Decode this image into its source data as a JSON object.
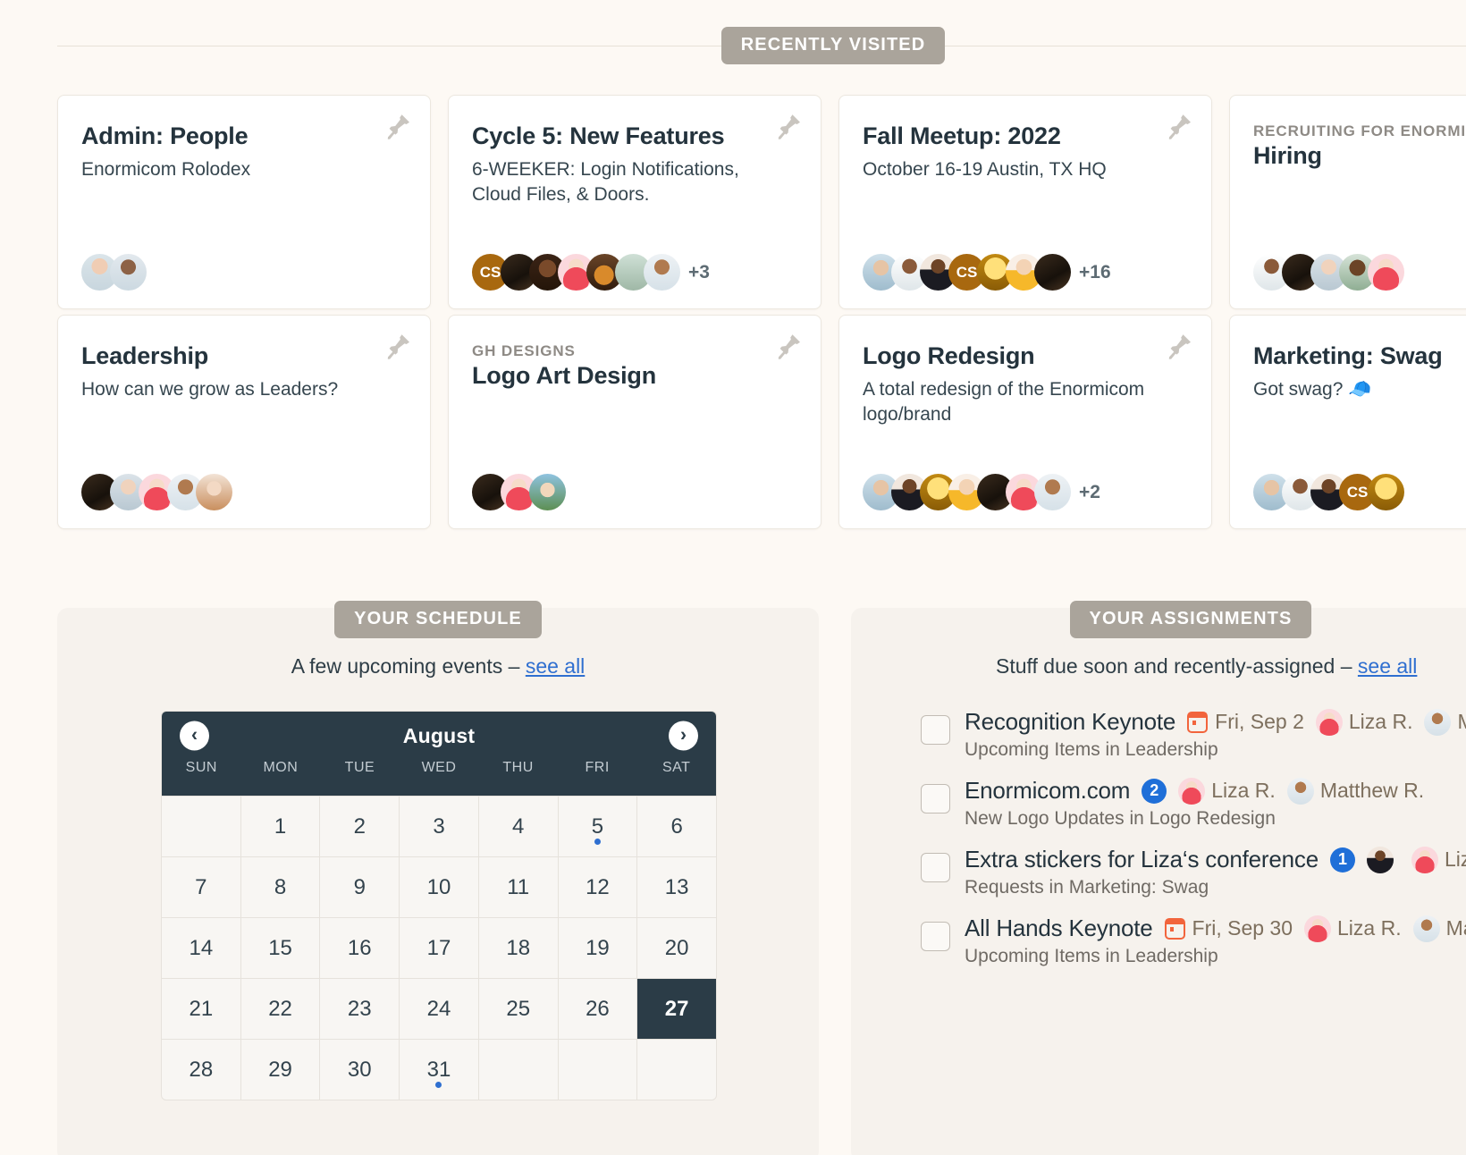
{
  "sections": {
    "recently_visited": "RECENTLY VISITED",
    "your_schedule": "YOUR SCHEDULE",
    "your_assignments": "YOUR ASSIGNMENTS"
  },
  "cards": [
    {
      "eyebrow": "",
      "title": "Admin: People",
      "sub": "Enormicom Rolodex",
      "avatars": [
        "a-w1",
        "a-m1"
      ],
      "more": ""
    },
    {
      "eyebrow": "",
      "title": "Cycle 5: New Features",
      "sub": "6-WEEKER: Login Notifications, Cloud Files, & Doors.",
      "avatars": [
        "a-cs",
        "a-dark",
        "a-curly",
        "a-pink",
        "a-dog",
        "a-out",
        "a-beard"
      ],
      "more": "+3"
    },
    {
      "eyebrow": "",
      "title": "Fall Meetup: 2022",
      "sub": "October 16-19 Austin, TX HQ",
      "avatars": [
        "a-glasses",
        "a-lab",
        "a-suit",
        "a-cs",
        "a-gold",
        "a-yellow",
        "a-dark"
      ],
      "more": "+16"
    },
    {
      "eyebrow": "RECRUITING FOR ENORMICOM",
      "title": "Hiring",
      "sub": "",
      "avatars": [
        "a-lab",
        "a-dark",
        "a-gray",
        "a-blkm",
        "a-pink"
      ],
      "more": ""
    },
    {
      "eyebrow": "",
      "title": "Leadership",
      "sub": "How can we grow as Leaders?",
      "avatars": [
        "a-dark",
        "a-gray",
        "a-pink",
        "a-beard",
        "a-redh"
      ],
      "more": ""
    },
    {
      "eyebrow": "GH DESIGNS",
      "title": "Logo Art Design",
      "sub": "",
      "avatars": [
        "a-dark",
        "a-pink",
        "a-sun"
      ],
      "more": ""
    },
    {
      "eyebrow": "",
      "title": "Logo Redesign",
      "sub": "A total redesign of the Enormicom logo/brand",
      "avatars": [
        "a-glasses",
        "a-suit",
        "a-gold",
        "a-yellow",
        "a-dark",
        "a-pink",
        "a-beard"
      ],
      "more": "+2"
    },
    {
      "eyebrow": "",
      "title": "Marketing: Swag",
      "sub": "Got swag? 🧢",
      "avatars": [
        "a-glasses",
        "a-lab",
        "a-suit",
        "a-cs",
        "a-gold"
      ],
      "more": ""
    }
  ],
  "schedule": {
    "lead_text": "A few upcoming events – ",
    "see_all": "see all",
    "calendar": {
      "month": "August",
      "prev": "‹",
      "next": "›",
      "dow": [
        "SUN",
        "MON",
        "TUE",
        "WED",
        "THU",
        "FRI",
        "SAT"
      ],
      "leading_blanks": 1,
      "days": 31,
      "today": 27,
      "event_days": [
        5,
        31
      ]
    }
  },
  "assignments": {
    "lead_text": "Stuff due soon and recently-assigned – ",
    "see_all": "see all",
    "items": [
      {
        "title": "Recognition Keynote",
        "due": "Fri, Sep 2",
        "badge": "",
        "people": [
          {
            "name": "Liza R.",
            "avatar": "a-pink"
          },
          {
            "name": "Matthew R.",
            "avatar": "a-beard"
          }
        ],
        "context": "Upcoming Items in Leadership"
      },
      {
        "title": "Enormicom.com",
        "due": "",
        "badge": "2",
        "people": [
          {
            "name": "Liza R.",
            "avatar": "a-pink"
          },
          {
            "name": "Matthew R.",
            "avatar": "a-beard"
          }
        ],
        "context": "New Logo Updates in Logo Redesign"
      },
      {
        "title": "Extra stickers for Liza‘s conference",
        "due": "",
        "badge": "1",
        "people": [
          {
            "name": "",
            "avatar": "a-suit"
          },
          {
            "name": "Liza R.",
            "avatar": "a-pink"
          }
        ],
        "context": "Requests in Marketing: Swag"
      },
      {
        "title": "All Hands Keynote",
        "due": "Fri, Sep 30",
        "badge": "",
        "people": [
          {
            "name": "Liza R.",
            "avatar": "a-pink"
          },
          {
            "name": "Matthew R.",
            "avatar": "a-beard"
          }
        ],
        "context": "Upcoming Items in Leadership"
      }
    ]
  },
  "colors": {
    "background": "#fdf9f4",
    "pill": "#aaa49b",
    "card_bg": "#ffffff",
    "panel_bg": "#f6f2ed",
    "calendar_header": "#2b3c47",
    "accent_link": "#2f6fd0",
    "badge_blue": "#1f6fd8",
    "due_orange": "#f2643c",
    "heading_text": "#24333d"
  }
}
